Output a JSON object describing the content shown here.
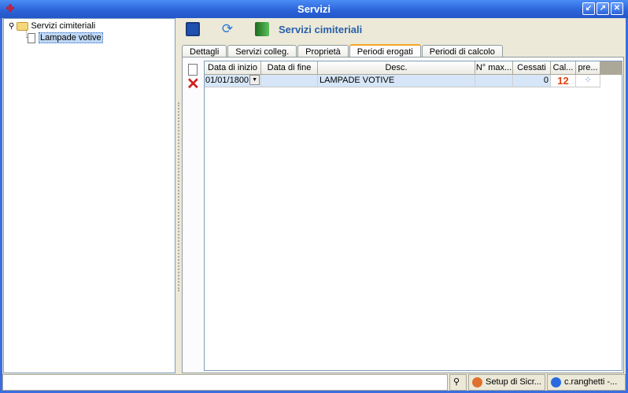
{
  "window": {
    "title": "Servizi"
  },
  "tree": {
    "root": "Servizi cimiteriali",
    "child": "Lampade votive"
  },
  "toolbar": {
    "title": "Servizi cimiteriali"
  },
  "tabs": [
    {
      "label": "Dettagli"
    },
    {
      "label": "Servizi colleg."
    },
    {
      "label": "Proprietà"
    },
    {
      "label": "Periodi erogati"
    },
    {
      "label": "Periodi di calcolo"
    }
  ],
  "grid": {
    "columns": [
      "Data di inizio",
      "Data di fine",
      "Desc.",
      "N° max...",
      "Cessati",
      "Cal...",
      "pre..."
    ],
    "rows": [
      {
        "start": "01/01/1800",
        "end": "",
        "desc": "LAMPADE VOTIVE",
        "max": "",
        "cessati": "0",
        "cal": "12",
        "pre": ""
      }
    ]
  },
  "status": {
    "panel1": "Setup di Sicr...",
    "panel2": "c.ranghetti -..."
  }
}
